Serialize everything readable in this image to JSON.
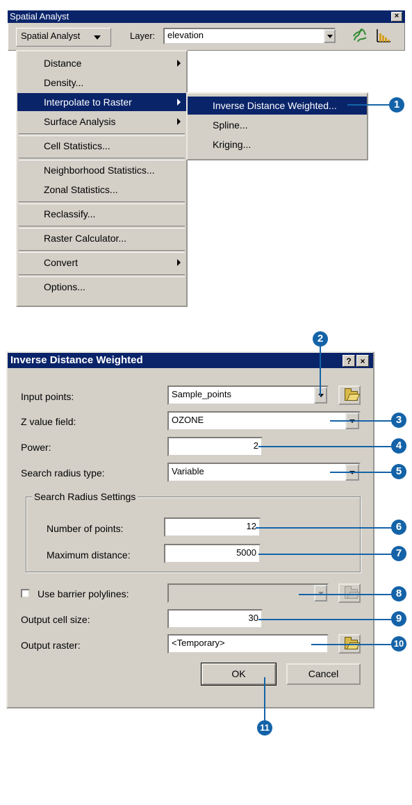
{
  "toolbar": {
    "title": "Spatial Analyst",
    "close_glyph": "×",
    "menu_button_label": "Spatial Analyst",
    "layer_label": "Layer:",
    "layer_value": "elevation",
    "icons": [
      "histogram-tool-icon",
      "create-contours-icon"
    ]
  },
  "menu": {
    "items": [
      {
        "label": "Distance",
        "submenu": true
      },
      {
        "label": "Density...",
        "submenu": false
      },
      {
        "label": "Interpolate to Raster",
        "submenu": true,
        "highlighted": true
      },
      {
        "label": "Surface Analysis",
        "submenu": true
      },
      {
        "label": "Cell Statistics...",
        "submenu": false
      },
      {
        "label": "Neighborhood Statistics...",
        "submenu": false
      },
      {
        "label": "Zonal Statistics...",
        "submenu": false
      },
      {
        "label": "Reclassify...",
        "submenu": false
      },
      {
        "label": "Raster Calculator...",
        "submenu": false
      },
      {
        "label": "Convert",
        "submenu": true
      },
      {
        "label": "Options...",
        "submenu": false
      }
    ]
  },
  "submenu": {
    "items": [
      {
        "label": "Inverse Distance Weighted...",
        "highlighted": true
      },
      {
        "label": "Spline..."
      },
      {
        "label": "Kriging..."
      }
    ]
  },
  "dialog": {
    "title": "Inverse Distance Weighted",
    "help_glyph": "?",
    "close_glyph": "×",
    "input_points_label": "Input points:",
    "input_points_value": "Sample_points",
    "z_field_label": "Z value field:",
    "z_field_value": "OZONE",
    "power_label": "Power:",
    "power_value": "2",
    "radius_type_label": "Search radius type:",
    "radius_type_value": "Variable",
    "group_label": "Search Radius Settings",
    "num_points_label": "Number of points:",
    "num_points_value": "12",
    "max_dist_label": "Maximum distance:",
    "max_dist_value": "5000",
    "barrier_label": "Use barrier polylines:",
    "barrier_checked": false,
    "barrier_value": "",
    "cell_size_label": "Output cell size:",
    "cell_size_value": "30",
    "output_raster_label": "Output raster:",
    "output_raster_value": "<Temporary>",
    "ok_label": "OK",
    "cancel_label": "Cancel"
  },
  "callouts": [
    "1",
    "2",
    "3",
    "4",
    "5",
    "6",
    "7",
    "8",
    "9",
    "10",
    "11"
  ],
  "colors": {
    "title_bar": "#0a246a",
    "face": "#d4d0c8",
    "highlight": "#0a246a",
    "callout": "#1463a8"
  }
}
